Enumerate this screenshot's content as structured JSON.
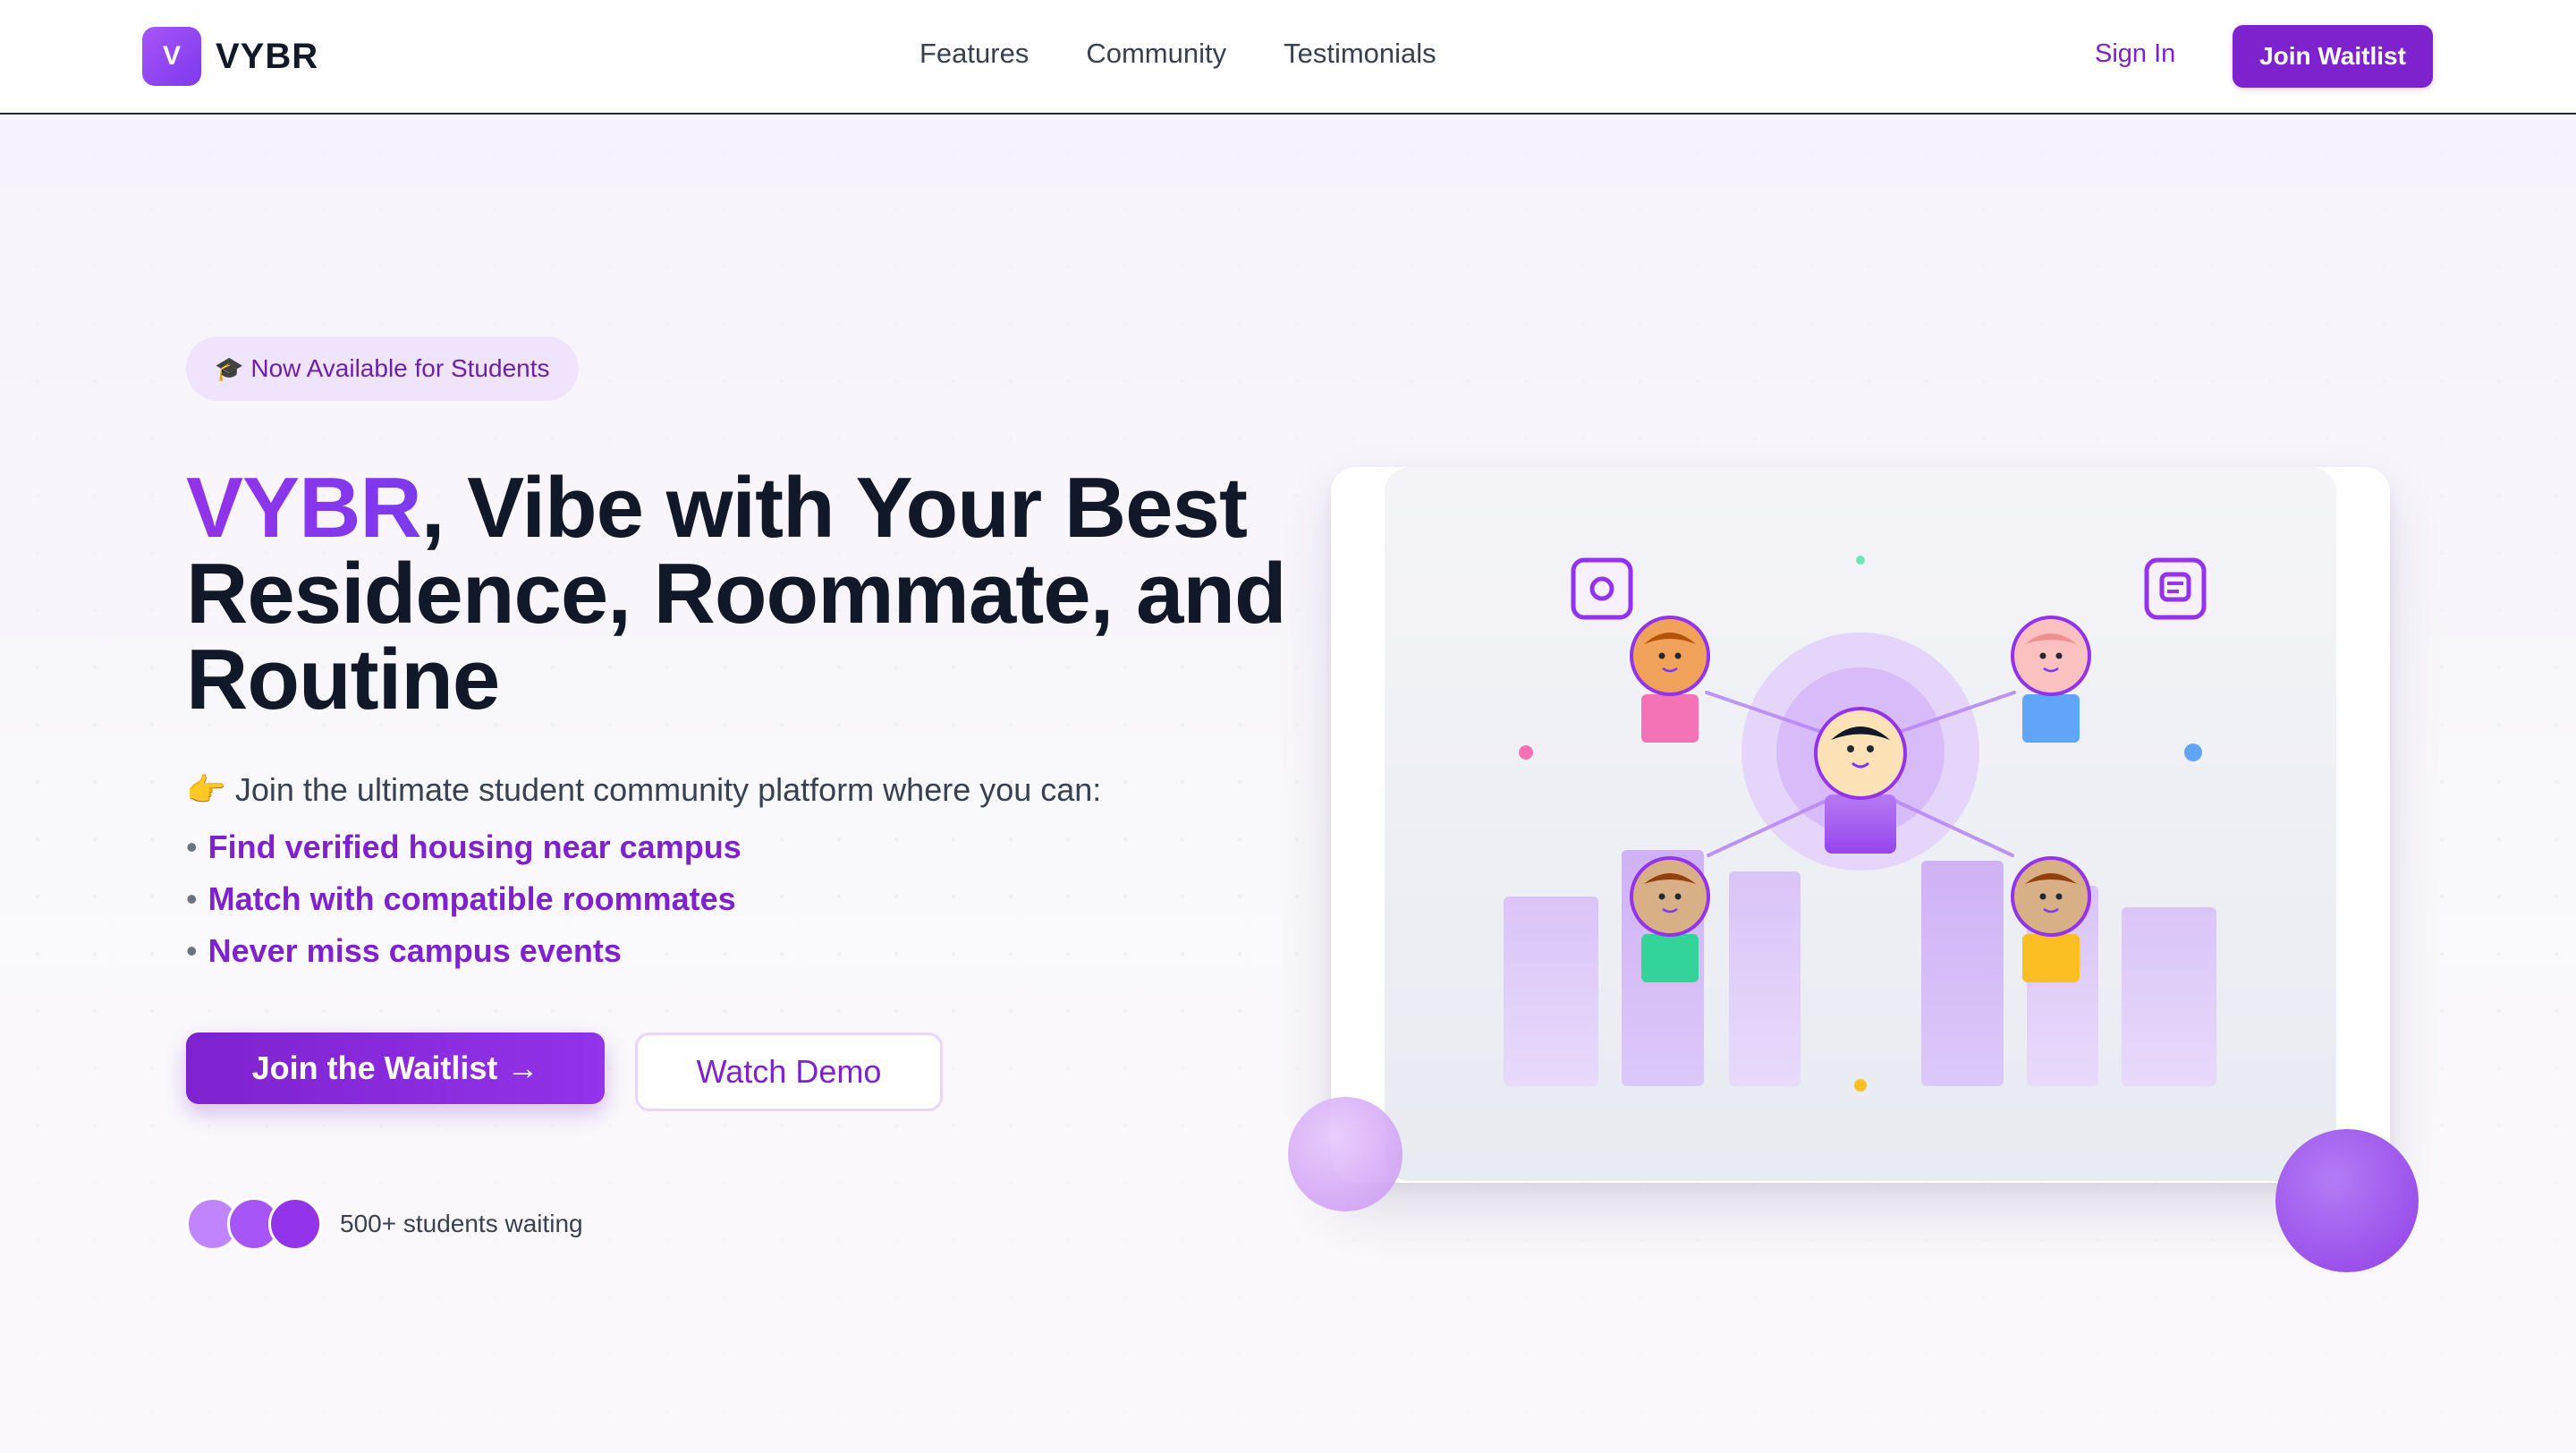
{
  "nav": {
    "logo_letter": "V",
    "brand": "VYBR",
    "links": [
      "Features",
      "Community",
      "Testimonials"
    ],
    "sign_in": "Sign In",
    "join": "Join Waitlist"
  },
  "hero": {
    "badge_icon": "🎓",
    "badge_text": "Now Available for Students",
    "headline_brand": "VYBR",
    "headline_rest": ", Vibe with Your Best Residence, Roommate, and Routine",
    "intro_icon": "👉",
    "intro_text": "Join the ultimate student community platform where you can:",
    "bullets": [
      "Find verified housing near campus",
      "Match with compatible roommates",
      "Never miss campus events"
    ],
    "cta_primary": "Join the Waitlist →",
    "cta_secondary": "Watch Demo",
    "waiting_text": "500+ students waiting"
  },
  "colors": {
    "accent": "#7e22ce",
    "accent_light": "#efe4fb",
    "text_dark": "#111827"
  },
  "icons": {
    "illustration": [
      "instagram-icon",
      "message-icon",
      "student-avatar-icon"
    ]
  }
}
